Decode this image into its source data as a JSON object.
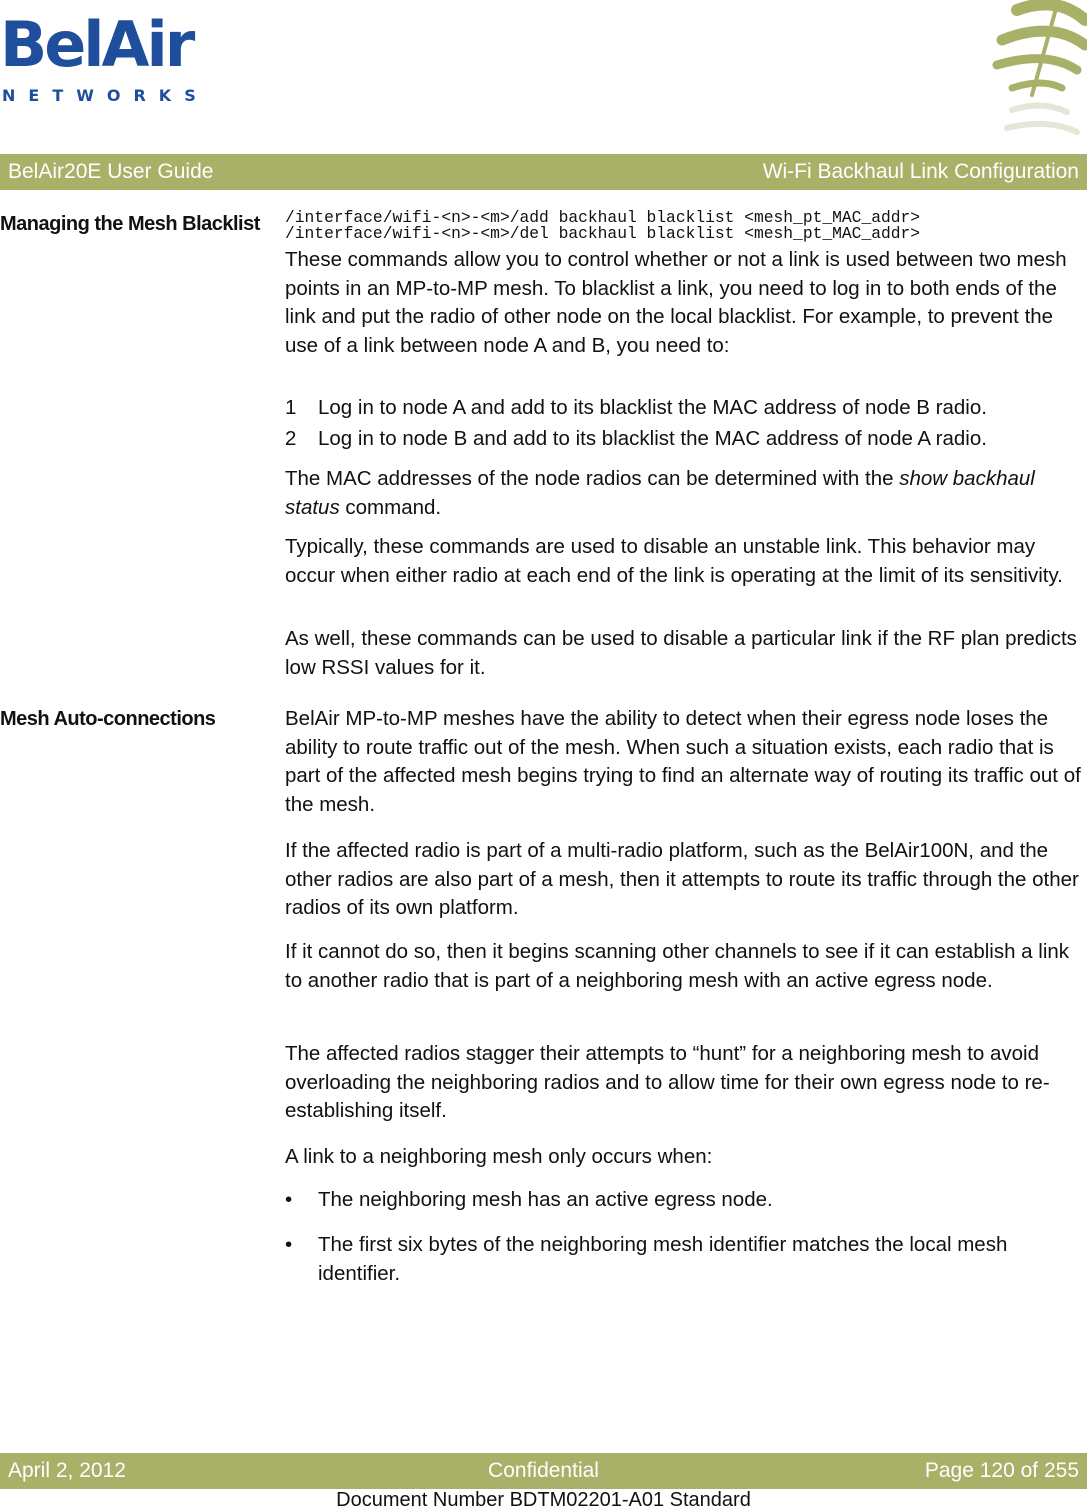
{
  "logo": {
    "brand": "BelAir",
    "subtitle": "NETWORKS",
    "brand_color": "#1e4e9c"
  },
  "header": {
    "left": "BelAir20E User Guide",
    "right": "Wi-Fi Backhaul Link Configuration",
    "bar_color": "#a9b068"
  },
  "sections": {
    "blacklist": {
      "title": "Managing the Mesh Blacklist",
      "code": [
        "/interface/wifi-<n>-<m>/add backhaul blacklist <mesh_pt_MAC_addr>",
        "/interface/wifi-<n>-<m>/del backhaul blacklist <mesh_pt_MAC_addr>"
      ],
      "p1": "These commands allow you to control whether or not a link is used between two mesh points in an MP-to-MP mesh. To blacklist a link, you need to log in to both ends of the link and put the radio of other node on the local blacklist. For example, to prevent the use of a link between node A and B, you need to:",
      "steps": [
        {
          "num": "1",
          "text": "Log in to node A and add to its blacklist the MAC address of node B radio."
        },
        {
          "num": "2",
          "text": "Log in to node B and add to its blacklist the MAC address of node A radio."
        }
      ],
      "p2_pre": "The MAC addresses of the node radios can be determined with the ",
      "p2_em": "show backhaul status",
      "p2_post": " command.",
      "p3": "Typically, these commands are used to disable an unstable link. This behavior may occur when either radio at each end of the link is operating at the limit of its sensitivity.",
      "p4": "As well, these commands can be used to disable a particular link if the RF plan predicts low RSSI values for it."
    },
    "auto": {
      "title": "Mesh Auto-connections",
      "p1": "BelAir MP-to-MP meshes have the ability to detect when their egress node loses the ability to route traffic out of the mesh. When such a situation exists, each radio that is part of the affected mesh begins trying to find an alternate way of routing its traffic out of the mesh.",
      "p2": "If the affected radio is part of a multi-radio platform, such as the BelAir100N, and the other radios are also part of a mesh, then it attempts to route its traffic through the other radios of its own platform.",
      "p3": "If it cannot do so, then it begins scanning other channels to see if it can establish a link to another radio that is part of a neighboring mesh with an active egress node.",
      "p4": "The affected radios stagger their attempts to “hunt” for a neighboring mesh to avoid overloading the neighboring radios and to allow time for their own egress node to re-establishing itself.",
      "p5": "A link to a neighboring mesh only occurs when:",
      "bullets": [
        {
          "mark": "•",
          "text": "The neighboring mesh has an active egress node."
        },
        {
          "mark": "•",
          "text": "The first six bytes of the neighboring mesh identifier matches the local mesh identifier."
        }
      ]
    }
  },
  "footer": {
    "date": "April 2, 2012",
    "classification": "Confidential",
    "page": "Page 120 of 255",
    "doc_number": "Document Number BDTM02201-A01 Standard"
  }
}
